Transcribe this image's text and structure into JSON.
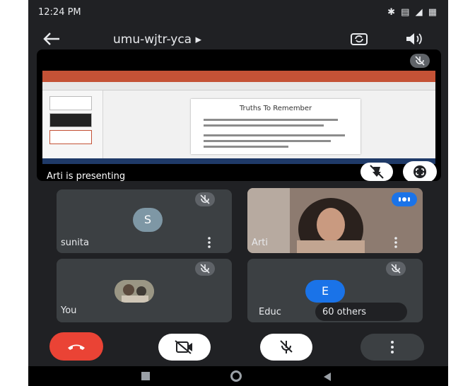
{
  "status": {
    "time": "12:24 PM",
    "right_icons": "✱ ▤ ◢ ▦"
  },
  "header": {
    "meeting_code": "umu-wjtr-yca ▸"
  },
  "presentation": {
    "slide_title": "Truths To Remember",
    "label": "Arti is presenting"
  },
  "participants": [
    {
      "name": "sunita",
      "avatar_letter": "S",
      "avatar_color": "#7e97a5"
    },
    {
      "name": "Arti"
    },
    {
      "name": "You"
    },
    {
      "name": "Educ",
      "avatar_letter": "E",
      "avatar_color": "#1a73e8",
      "others": "60 others"
    }
  ],
  "icons": {
    "back": "back-arrow-icon",
    "rotate": "camera-switch-icon",
    "speaker": "speaker-icon",
    "mic_off": "mic-off-icon",
    "more": "more-vert-icon"
  },
  "colors": {
    "end_call": "#ea4335",
    "accent": "#1a73e8"
  }
}
